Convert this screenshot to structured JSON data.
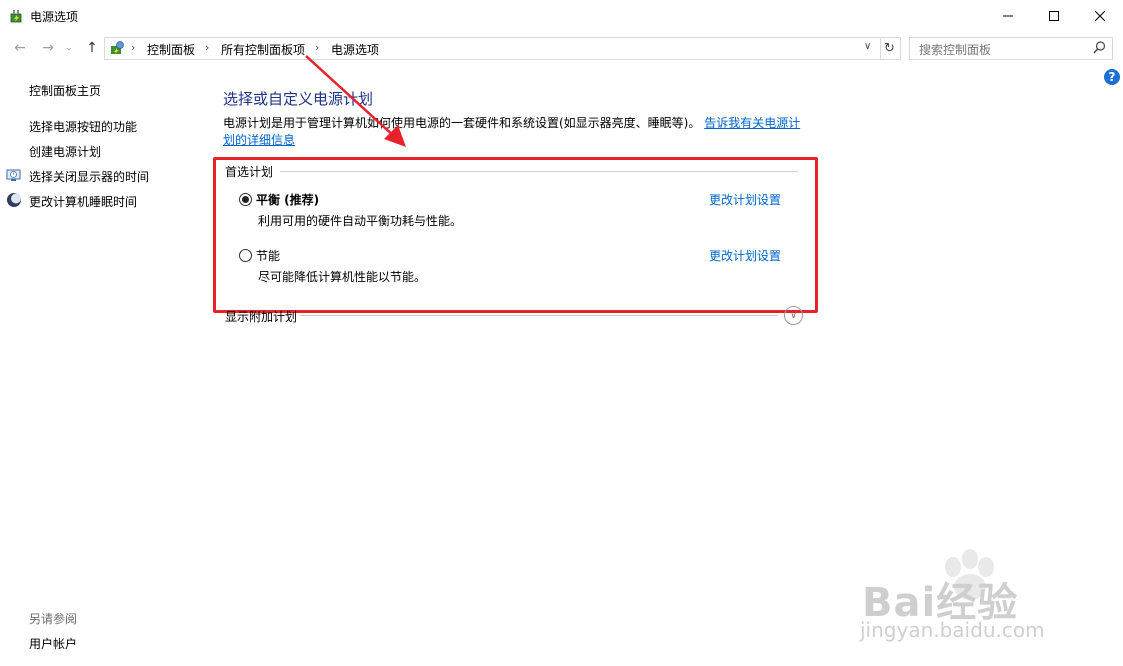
{
  "window": {
    "title": "电源选项",
    "min_icon": "minimize-icon",
    "max_icon": "maximize-icon",
    "close_icon": "close-icon"
  },
  "address": {
    "crumbs": [
      "控制面板",
      "所有控制面板项",
      "电源选项"
    ],
    "search_placeholder": "搜索控制面板"
  },
  "sidebar": {
    "home": "控制面板主页",
    "links": [
      "选择电源按钮的功能",
      "创建电源计划",
      "选择关闭显示器的时间",
      "更改计算机睡眠时间"
    ],
    "see_also_label": "另请参阅",
    "see_also_links": [
      "用户帐户"
    ]
  },
  "main": {
    "heading": "选择或自定义电源计划",
    "description": "电源计划是用于管理计算机如何使用电源的一套硬件和系统设置(如显示器亮度、睡眠等)。",
    "description_link": "告诉我有关电源计划的详细信息",
    "preferred_label": "首选计划",
    "plans": [
      {
        "name": "平衡 (推荐)",
        "desc": "利用可用的硬件自动平衡功耗与性能。",
        "selected": true,
        "link": "更改计划设置"
      },
      {
        "name": "节能",
        "desc": "尽可能降低计算机性能以节能。",
        "selected": false,
        "link": "更改计划设置"
      }
    ],
    "extra_label": "显示附加计划"
  },
  "watermark": {
    "brand": "Bai经验",
    "url": "jingyan.baidu.com"
  },
  "colors": {
    "heading": "#1e3287",
    "link": "#0066cc",
    "highlight_box": "#e8222a",
    "help": "#1c6fd3"
  }
}
